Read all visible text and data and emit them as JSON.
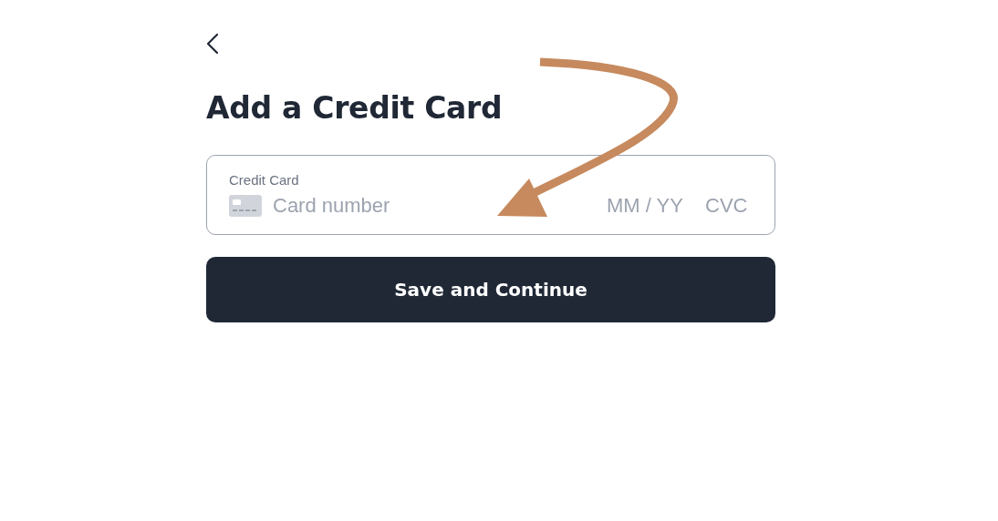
{
  "title": "Add a Credit Card",
  "card_field": {
    "label": "Credit Card",
    "number_placeholder": "Card number",
    "expiry_placeholder": "MM / YY",
    "cvc_placeholder": "CVC"
  },
  "submit_button": "Save and Continue",
  "annotation": {
    "kind": "arrow",
    "color": "#c68a5e"
  }
}
